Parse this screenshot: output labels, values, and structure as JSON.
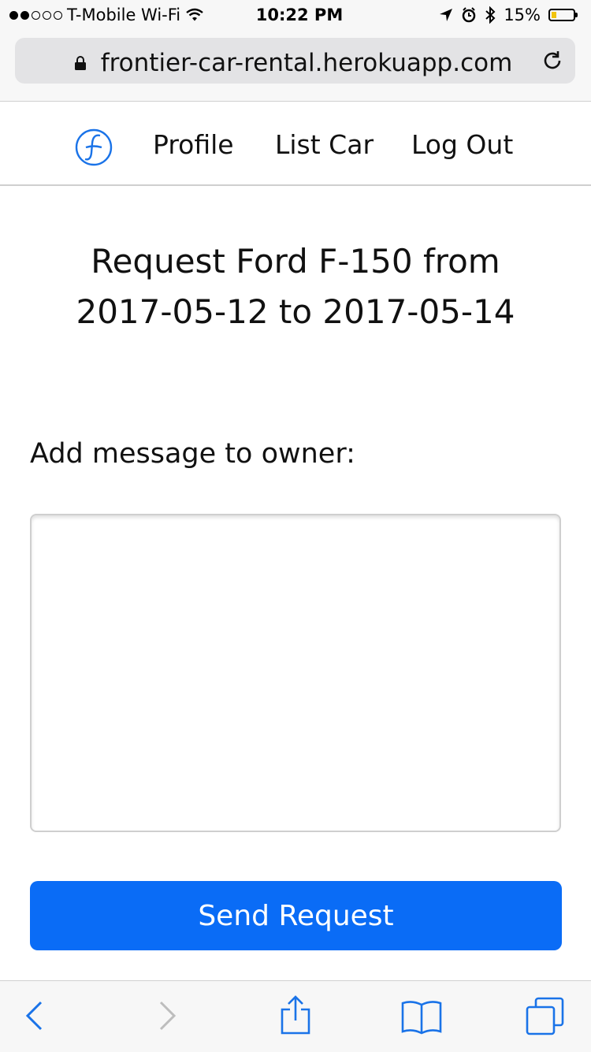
{
  "statusbar": {
    "carrier": "T-Mobile Wi-Fi",
    "time": "10:22 PM",
    "battery": "15%",
    "icons": [
      "wifi-icon",
      "location-icon",
      "alarm-icon",
      "bluetooth-icon",
      "battery-icon"
    ]
  },
  "browser": {
    "url": "frontier-car-rental.herokuapp.com"
  },
  "nav": {
    "links": [
      "Profile",
      "List Car",
      "Log Out"
    ]
  },
  "page": {
    "title_line1": "Request Ford F-150 from",
    "title_line2": "2017-05-12 to 2017-05-14",
    "message_label": "Add message to owner:",
    "message_value": "",
    "send_label": "Send Request"
  },
  "colors": {
    "accent": "#0a6cf6",
    "browser_icon": "#1a73e8"
  }
}
